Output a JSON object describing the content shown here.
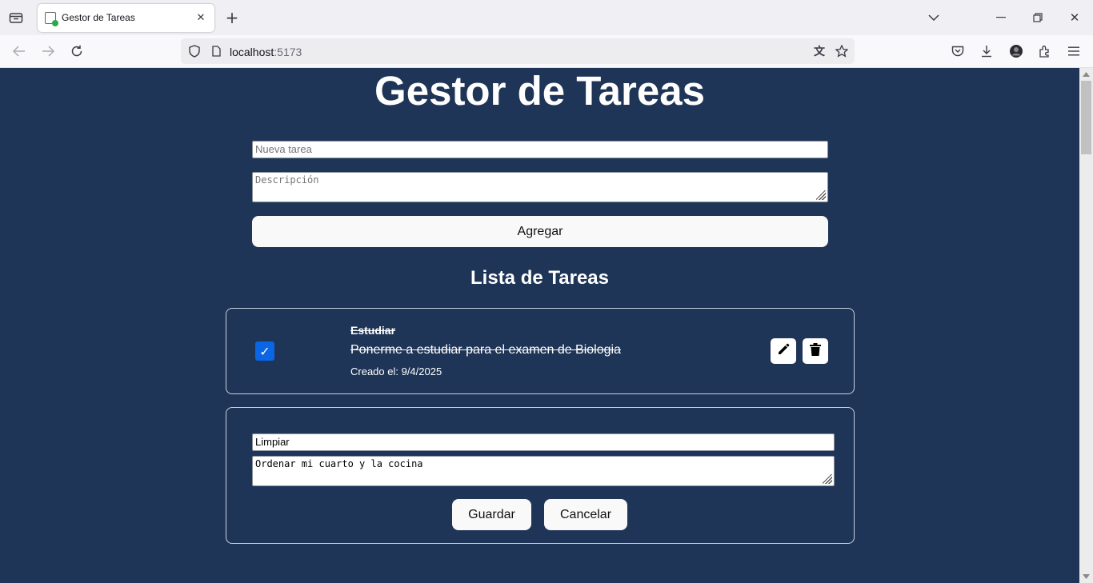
{
  "browser": {
    "tab_title": "Gestor de Tareas",
    "url_host": "localhost",
    "url_port": ":5173"
  },
  "app": {
    "title": "Gestor de Tareas",
    "new_task_placeholder": "Nueva tarea",
    "description_placeholder": "Descripción",
    "add_button": "Agregar",
    "list_title": "Lista de Tareas"
  },
  "tasks": [
    {
      "title": "Estudiar",
      "description": "Ponerme a estudiar para el examen de Biologia",
      "created": "Creado el: 9/4/2025",
      "completed": true
    }
  ],
  "edit_form": {
    "title_value": "Limpiar",
    "description_value": "Ordenar mi cuarto y la cocina",
    "save_button": "Guardar",
    "cancel_button": "Cancelar"
  },
  "colors": {
    "page_background": "#1f3557",
    "checkbox": "#0a66e4"
  }
}
